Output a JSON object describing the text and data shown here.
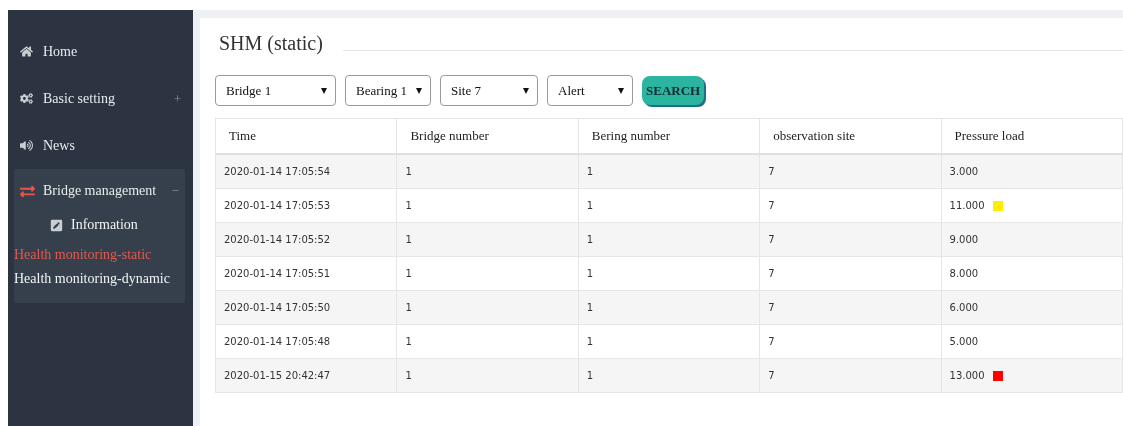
{
  "sidebar": {
    "items": [
      {
        "label": "Home"
      },
      {
        "label": "Basic setting",
        "toggle": "+"
      },
      {
        "label": "News"
      },
      {
        "label": "Bridge management",
        "toggle": "−",
        "children": [
          {
            "label": "Information",
            "selected": false
          },
          {
            "label": "Health monitoring-static",
            "selected": true
          },
          {
            "label": "Health monitoring-dynamic",
            "selected": false
          }
        ]
      }
    ]
  },
  "page": {
    "title": "SHM (static)"
  },
  "filters": [
    {
      "value": "Bridge 1"
    },
    {
      "value": "Bearing 1"
    },
    {
      "value": "Site 7"
    },
    {
      "value": "Alert"
    }
  ],
  "search_button": "SEARCH",
  "table": {
    "columns": [
      "Time",
      "Bridge number",
      "Bering number",
      "observation site",
      "Pressure load"
    ],
    "rows": [
      {
        "cells": [
          "2020-01-14 17:05:54",
          "1",
          "1",
          "7",
          "3.000"
        ]
      },
      {
        "cells": [
          "2020-01-14 17:05:53",
          "1",
          "1",
          "7",
          "11.000"
        ],
        "color": "#ffee00"
      },
      {
        "cells": [
          "2020-01-14 17:05:52",
          "1",
          "1",
          "7",
          "9.000"
        ]
      },
      {
        "cells": [
          "2020-01-14 17:05:51",
          "1",
          "1",
          "7",
          "8.000"
        ]
      },
      {
        "cells": [
          "2020-01-14 17:05:50",
          "1",
          "1",
          "7",
          "6.000"
        ]
      },
      {
        "cells": [
          "2020-01-14 17:05:48",
          "1",
          "1",
          "7",
          "5.000"
        ]
      },
      {
        "cells": [
          "2020-01-15 20:42:47",
          "1",
          "1",
          "7",
          "13.000"
        ],
        "color": "#ff0000"
      }
    ]
  }
}
